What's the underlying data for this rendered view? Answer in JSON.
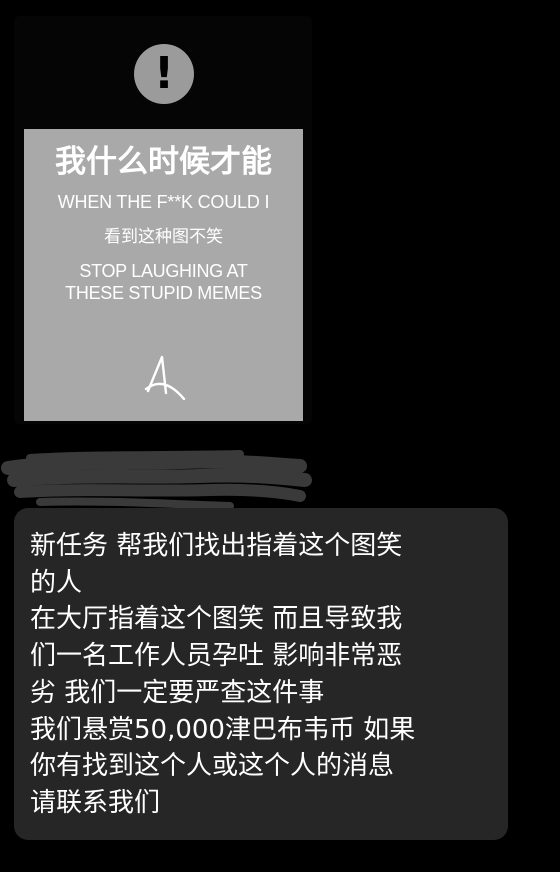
{
  "image_message": {
    "status_icon": "exclamation-icon",
    "meme": {
      "title_cn": "我什么时候才能",
      "title_en": "WHEN THE F**K COULD I",
      "subtitle_cn": "看到这种图不笑",
      "subtitle_en": "STOP LAUGHING AT\nTHESE STUPID MEMES",
      "signature": "A"
    }
  },
  "text_message": {
    "body": "新任务 帮我们找出指着这个图笑\n的人\n在大厅指着这个图笑 而且导致我\n们一名工作人员孕吐 影响非常恶\n劣 我们一定要严查这件事\n我们悬赏50,000津巴布韦币 如果\n你有找到这个人或这个人的消息\n请联系我们"
  },
  "colors": {
    "background": "#000000",
    "bubble": "#262626",
    "meme_card": "#a9a9a9",
    "status_icon": "#9b9b9b"
  }
}
